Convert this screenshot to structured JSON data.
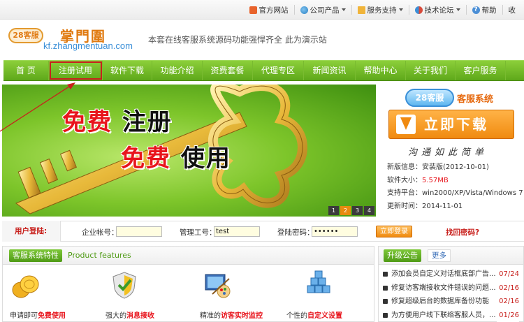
{
  "topbar": {
    "links": [
      {
        "icon": "home-icon",
        "label": "官方网站",
        "caret": false
      },
      {
        "icon": "globe-icon",
        "label": "公司产品",
        "caret": true
      },
      {
        "icon": "folder-icon",
        "label": "服务支持",
        "caret": true
      },
      {
        "icon": "people-icon",
        "label": "技术论坛",
        "caret": true
      },
      {
        "icon": "help-icon",
        "label": "帮助",
        "caret": false
      },
      {
        "icon": "",
        "label": "收",
        "caret": false
      }
    ]
  },
  "header": {
    "logo_badge": "28客服",
    "logo_cn": "掌門圍",
    "logo_url": "kf.zhangmentuan.com",
    "tagline": "本套在线客服系统源码功能强悍齐全 此为演示站"
  },
  "nav": {
    "items": [
      "首 页",
      "注册试用",
      "软件下载",
      "功能介绍",
      "资费套餐",
      "代理专区",
      "新闻资讯",
      "帮助中心",
      "关于我们",
      "客户服务"
    ],
    "active_index": 1
  },
  "banner": {
    "line1_red": "免费",
    "line1_black": "注册",
    "line2_red": "免费",
    "line2_black": "使用",
    "pager": [
      "1",
      "2",
      "3",
      "4"
    ],
    "pager_active": 1
  },
  "download": {
    "brand_badge": "28客服",
    "brand_text": "客服系统",
    "button_label": "立即下载",
    "slogan": "沟通如此简单",
    "info": [
      {
        "label": "新版信息：",
        "value": "安装版(2012-10-01)",
        "red": false
      },
      {
        "label": "软件大小：",
        "value": "5.57MB",
        "red": true
      },
      {
        "label": "支持平台：",
        "value": "win2000/XP/Vista/Windows 7",
        "red": false
      },
      {
        "label": "更新时间：",
        "value": "2014-11-01",
        "red": false
      }
    ]
  },
  "login": {
    "title": "用户登陆:",
    "company_label": "企业帐号：",
    "company_value": "",
    "staff_label": "管理工号：",
    "staff_value": "test",
    "password_label": "登陆密码：",
    "password_value": "••••••",
    "submit_label": "立即登录",
    "forgot_label": "找回密码?"
  },
  "features": {
    "title_cn": "客服系统特性",
    "title_en": "Product features",
    "items": [
      {
        "icon": "coins-icon",
        "prefix": "申请即可",
        "highlight": "免费使用"
      },
      {
        "icon": "shield-check-icon",
        "prefix": "强大的",
        "highlight": "消息接收"
      },
      {
        "icon": "monitor-palette-icon",
        "prefix": "精准的",
        "highlight": "访客实时监控"
      },
      {
        "icon": "cubes-icon",
        "prefix": "个性的",
        "highlight": "自定义设置"
      }
    ]
  },
  "announcements": {
    "title": "升级公告",
    "more_label": "更多",
    "items": [
      {
        "text": "添加会员自定义对话框底部广告...",
        "date": "07/24"
      },
      {
        "text": "修复访客端接收文件错误的问题...",
        "date": "02/16"
      },
      {
        "text": "修复超级后台的数据库备份功能",
        "date": "02/16"
      },
      {
        "text": "为方便用户线下联络客服人员，...",
        "date": "01/26"
      }
    ]
  },
  "colors": {
    "nav_green": "#6bb323",
    "accent_orange": "#f08a10",
    "alert_red": "#e8141c"
  }
}
